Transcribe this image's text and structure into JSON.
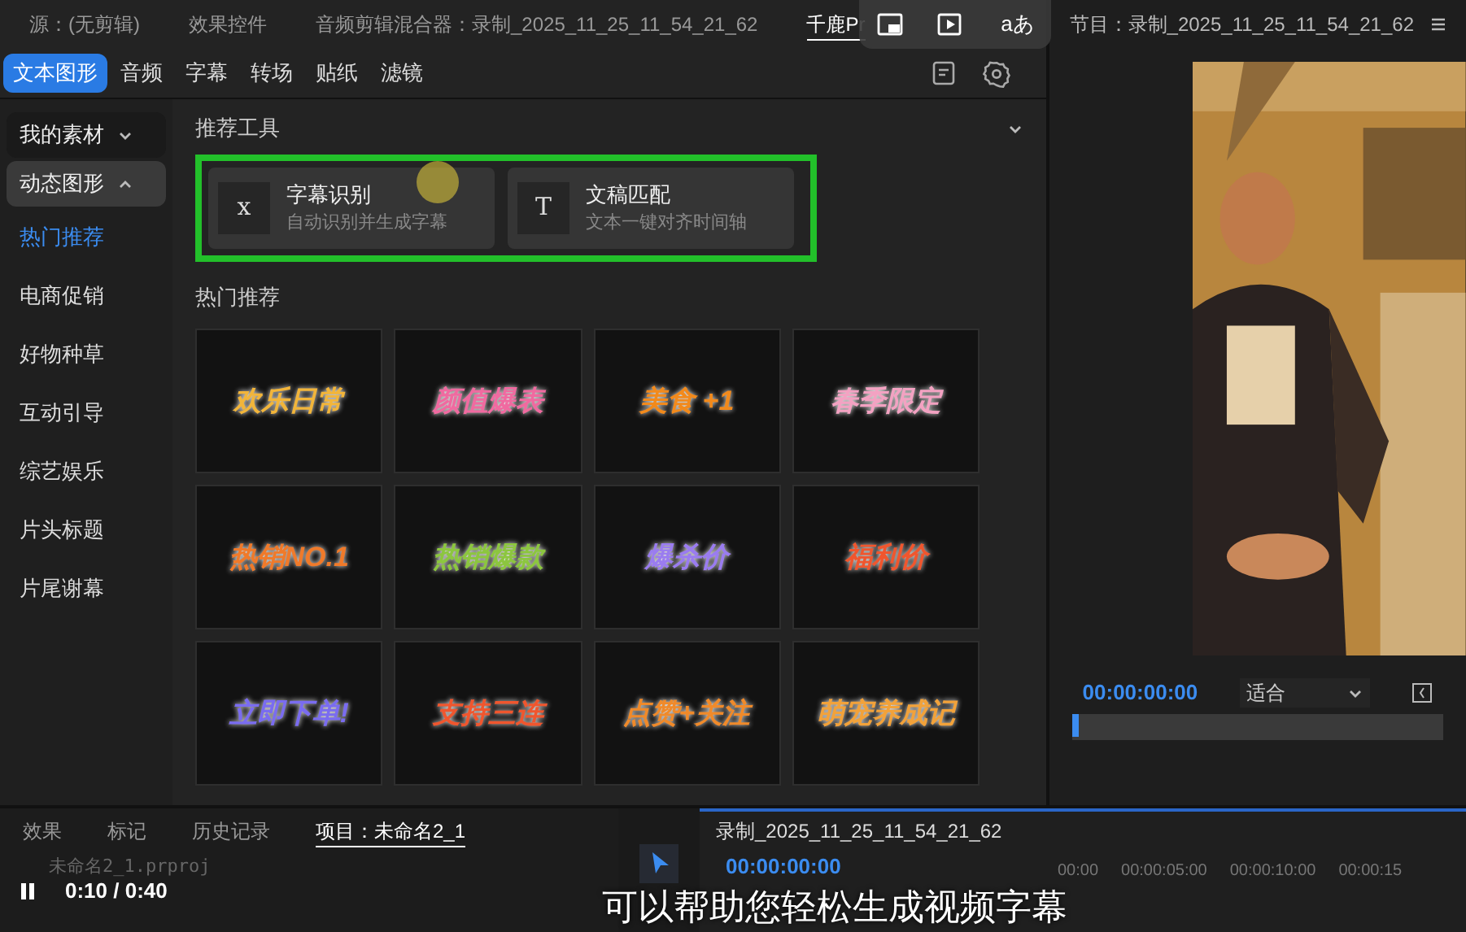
{
  "top_tabs": [
    {
      "label": "源：(无剪辑)",
      "selected": false
    },
    {
      "label": "效果控件",
      "selected": false
    },
    {
      "label": "音频剪辑混合器：录制_2025_11_25_11_54_21_62",
      "selected": false
    },
    {
      "label": "千鹿Pr",
      "selected": true
    }
  ],
  "overlay_controls": {
    "translate_label": "aあ"
  },
  "category_tabs": [
    {
      "label": "文本图形",
      "selected": true
    },
    {
      "label": "音频",
      "selected": false
    },
    {
      "label": "字幕",
      "selected": false
    },
    {
      "label": "转场",
      "selected": false
    },
    {
      "label": "贴纸",
      "selected": false
    },
    {
      "label": "滤镜",
      "selected": false
    }
  ],
  "sidebar": {
    "groups": [
      {
        "label": "我的素材",
        "expanded": false
      },
      {
        "label": "动态图形",
        "expanded": true,
        "children": [
          {
            "label": "热门推荐",
            "selected": true
          },
          {
            "label": "电商促销",
            "selected": false
          },
          {
            "label": "好物种草",
            "selected": false
          },
          {
            "label": "互动引导",
            "selected": false
          },
          {
            "label": "综艺娱乐",
            "selected": false
          },
          {
            "label": "片头标题",
            "selected": false
          },
          {
            "label": "片尾谢幕",
            "selected": false
          }
        ]
      }
    ]
  },
  "recommended_tools": {
    "title": "推荐工具",
    "tools": [
      {
        "title": "字幕识别",
        "subtitle": "自动识别并生成字幕",
        "glyph": "x"
      },
      {
        "title": "文稿匹配",
        "subtitle": "文本一键对齐时间轴",
        "glyph": "T"
      }
    ]
  },
  "hot": {
    "title": "热门推荐",
    "stickers": [
      {
        "text": "欢乐日常",
        "color": "#f2b53a"
      },
      {
        "text": "颜值爆表",
        "color": "#f06aa0"
      },
      {
        "text": "美食 +1",
        "color": "#f28a1c"
      },
      {
        "text": "春季限定",
        "color": "#f3a2c2"
      },
      {
        "text": "热销NO.1",
        "color": "#f07a2a"
      },
      {
        "text": "热销爆款",
        "color": "#8cc63f"
      },
      {
        "text": "爆杀价",
        "color": "#9a7cf0"
      },
      {
        "text": "福利价",
        "color": "#f0562e"
      },
      {
        "text": "立即下单!",
        "color": "#7a6cf0"
      },
      {
        "text": "支持三连",
        "color": "#f0562e"
      },
      {
        "text": "点赞+关注",
        "color": "#f08a2a"
      },
      {
        "text": "萌宠养成记",
        "color": "#f2a23a"
      }
    ]
  },
  "program_monitor": {
    "title": "节目：录制_2025_11_25_11_54_21_62",
    "timecode": "00:00:00:00",
    "zoom": "适合"
  },
  "bottom_tabs": [
    {
      "label": "效果",
      "selected": false
    },
    {
      "label": "标记",
      "selected": false
    },
    {
      "label": "历史记录",
      "selected": false
    },
    {
      "label": "项目：未命名2_1",
      "selected": true
    }
  ],
  "project_file": "未命名2_1.prproj",
  "timeline": {
    "title": "录制_2025_11_25_11_54_21_62",
    "timecode": "00:00:00:00",
    "ruler": [
      "00:00",
      "00:00:05:00",
      "00:00:10:00",
      "00:00:15"
    ]
  },
  "player": {
    "time": "0:10 / 0:40",
    "playing": true,
    "caption": "可以帮助您轻松生成视频字幕"
  }
}
